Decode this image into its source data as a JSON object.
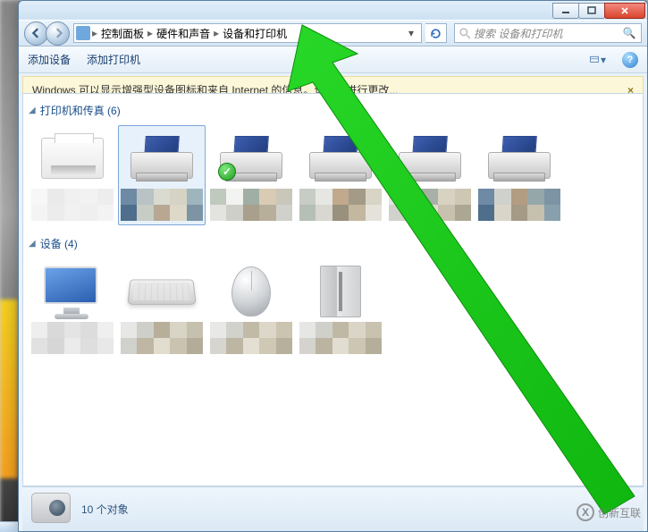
{
  "window": {
    "sys": {
      "min": "–",
      "max": "□",
      "close": "×"
    }
  },
  "breadcrumb": {
    "root_icon": "devices-icon",
    "items": [
      "控制面板",
      "硬件和声音",
      "设备和打印机"
    ]
  },
  "search": {
    "placeholder": "搜索 设备和打印机"
  },
  "toolbar": {
    "add_device": "添加设备",
    "add_printer": "添加打印机"
  },
  "infobar": {
    "message": "Windows 可以显示增强型设备图标和来自 Internet 的信息。请单击进行更改...",
    "close": "×"
  },
  "groups": [
    {
      "title": "打印机和传真 (6)",
      "items": [
        {
          "kind": "fax",
          "selected": false,
          "default": false,
          "pix": [
            "#f7f7f7",
            "#eaeaea",
            "#f0f0f0",
            "#f2f2f2",
            "#ededed",
            "#f4f4f4",
            "#ececec",
            "#f1f1f1",
            "#efefef",
            "#f3f3f3"
          ]
        },
        {
          "kind": "printer",
          "selected": true,
          "default": false,
          "pix": [
            "#6f8aa4",
            "#b9c3c5",
            "#d9dad0",
            "#d6d3c4",
            "#9fb5be",
            "#4f6e8b",
            "#c7ccc5",
            "#b8a893",
            "#ded8c8",
            "#7c94a4"
          ]
        },
        {
          "kind": "printer",
          "selected": false,
          "default": true,
          "pix": [
            "#bfc9bd",
            "#f3f3f1",
            "#a1aea6",
            "#d9cbb4",
            "#c9c7ba",
            "#e3e3e0",
            "#cfcfca",
            "#a8a08c",
            "#b7af9a",
            "#d0d1cb"
          ]
        },
        {
          "kind": "printer",
          "selected": false,
          "default": false,
          "pix": [
            "#c7ccc5",
            "#e6e6e3",
            "#c1a98d",
            "#a49a88",
            "#d8d4c6",
            "#b6bfb6",
            "#d8d7d0",
            "#99907d",
            "#c3b79f",
            "#e4e2da"
          ]
        },
        {
          "kind": "printer",
          "selected": false,
          "default": false,
          "pix": [
            "#e4e4e1",
            "#c2c5ba",
            "#a7b1a7",
            "#d8d2c2",
            "#cec7b3",
            "#d2d2cd",
            "#b9b3a1",
            "#e1ddcf",
            "#c8c1ad",
            "#aca793"
          ]
        },
        {
          "kind": "printer",
          "selected": false,
          "default": false,
          "pix": [
            "#6f8aa4",
            "#cfd2cc",
            "#b29d82",
            "#96a7aa",
            "#7c94a4",
            "#4f6e8b",
            "#d9d6c9",
            "#a59a86",
            "#c6c0ae",
            "#88a0ad"
          ]
        }
      ]
    },
    {
      "title": "设备 (4)",
      "items": [
        {
          "kind": "monitor",
          "selected": false,
          "pix": [
            "#eeeeee",
            "#d9d9d9",
            "#e4e4e4",
            "#dcdcdc",
            "#efefef",
            "#e1e1e1",
            "#d6d6d6",
            "#ebebeb",
            "#dedede",
            "#e8e8e8"
          ]
        },
        {
          "kind": "keyboard",
          "selected": false,
          "pix": [
            "#e7e7e5",
            "#cfcfca",
            "#b7af9a",
            "#d8d4c6",
            "#c6c0ae",
            "#d0d1cb",
            "#bfb7a3",
            "#e1ddcf",
            "#cac3af",
            "#b3ac98"
          ]
        },
        {
          "kind": "mouse",
          "selected": false,
          "pix": [
            "#e8e8e6",
            "#d2d2cd",
            "#c1baa7",
            "#dcd7c8",
            "#cac4b1",
            "#d6d5cf",
            "#bdb6a2",
            "#e3dfd2",
            "#cec8b5",
            "#b6b09c"
          ]
        },
        {
          "kind": "drive",
          "selected": false,
          "pix": [
            "#e6e6e4",
            "#d0d0cb",
            "#bfb8a5",
            "#dad5c6",
            "#c8c2af",
            "#d4d3cd",
            "#bbb4a0",
            "#e1ddd0",
            "#ccc6b3",
            "#b4ae9a"
          ]
        }
      ]
    }
  ],
  "statusbar": {
    "count_text": "10 个对象"
  },
  "watermark": {
    "text": "创新互联",
    "logo_text": "X"
  }
}
